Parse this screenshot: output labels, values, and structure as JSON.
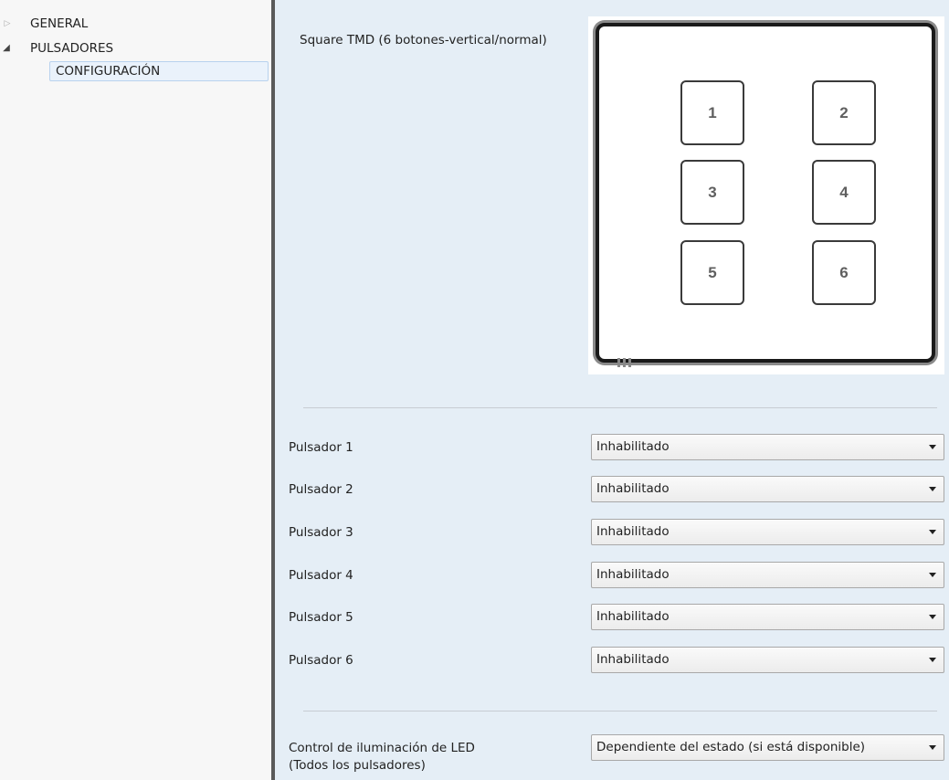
{
  "tree": {
    "items": [
      {
        "label": "GENERAL",
        "icon": "triangle-right-icon"
      },
      {
        "label": "PULSADORES",
        "icon": "triangle-down-icon"
      },
      {
        "label": "CONFIGURACIÓN",
        "selected": true
      }
    ]
  },
  "device": {
    "label": "Square TMD (6 botones-vertical/normal)",
    "keys": [
      "1",
      "2",
      "3",
      "4",
      "5",
      "6"
    ]
  },
  "buttons": [
    {
      "label": "Pulsador 1",
      "value": "Inhabilitado"
    },
    {
      "label": "Pulsador 2",
      "value": "Inhabilitado"
    },
    {
      "label": "Pulsador 3",
      "value": "Inhabilitado"
    },
    {
      "label": "Pulsador 4",
      "value": "Inhabilitado"
    },
    {
      "label": "Pulsador 5",
      "value": "Inhabilitado"
    },
    {
      "label": "Pulsador 6",
      "value": "Inhabilitado"
    }
  ],
  "led": {
    "label_line1": "Control de iluminación de LED",
    "label_line2": "(Todos los pulsadores)",
    "value": "Dependiente del estado (si está disponible)"
  },
  "colors": {
    "tree_background": "#f7f7f7",
    "content_background": "#e5eef6",
    "selection": "#eaf2fb",
    "splitter": "#5a5a5a"
  }
}
